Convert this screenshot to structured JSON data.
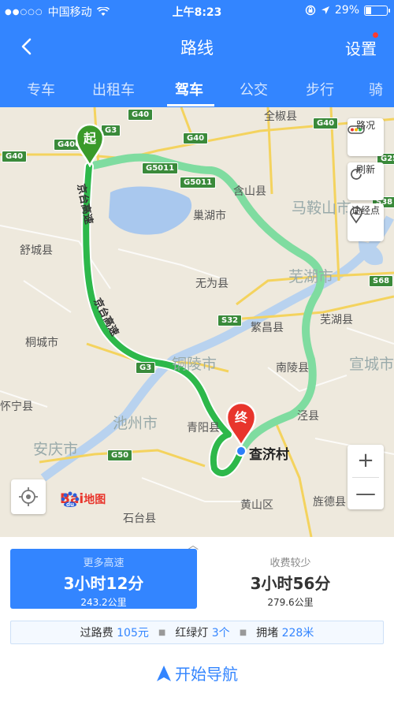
{
  "status_bar": {
    "carrier": "中国移动",
    "time": "上午8:23",
    "battery": "29%",
    "battery_level": 0.29
  },
  "nav": {
    "title": "路线",
    "settings": "设置"
  },
  "tabs": [
    "专车",
    "出租车",
    "驾车",
    "公交",
    "步行",
    "骑"
  ],
  "active_tab": "驾车",
  "map": {
    "start_label": "起",
    "end_label": "终",
    "destination": "查济村",
    "places": {
      "quanjiao": "全椒县",
      "hanshan": "含山县",
      "chaohu": "巢湖市",
      "maanshan": "马鞍山市",
      "shucheng": "舒城县",
      "wuhu_city": "芜湖市",
      "wuwei": "无为县",
      "tongcheng": "桐城市",
      "fanchang": "繁昌县",
      "wuhu_county": "芜湖县",
      "tongling": "铜陵市",
      "nanling": "南陵县",
      "xuancheng": "宣城市",
      "huaining": "怀宁县",
      "chizhou": "池州市",
      "qingyang": "青阳县",
      "jingxian": "泾县",
      "anqing": "安庆市",
      "huangshan_district": "黄山区",
      "jingde": "旌德县",
      "shitai": "石台县"
    },
    "road_names": [
      "京台高速",
      "京台高速"
    ],
    "shields": [
      "G40",
      "G3",
      "G40",
      "G400",
      "G40",
      "G5011",
      "G5011",
      "G40",
      "G2501",
      "S38",
      "S68",
      "S32",
      "G3",
      "G50"
    ],
    "buttons": {
      "traffic": "路况",
      "refresh": "刷新",
      "waypoints": "途经点",
      "zoom_in": "+",
      "zoom_out": "—"
    },
    "logo": {
      "bai": "Bai",
      "du": "du",
      "ditu": "地图"
    }
  },
  "routes": [
    {
      "tag": "更多高速",
      "time": "3小时12分",
      "distance": "243.2公里"
    },
    {
      "tag": "收费较少",
      "time": "3小时56分",
      "distance": "279.6公里"
    }
  ],
  "info": {
    "toll_label": "过路费",
    "toll_value": "105元",
    "lights_label": "红绿灯",
    "lights_value": "3个",
    "jam_label": "拥堵",
    "jam_value": "228米"
  },
  "start_navigation": "开始导航",
  "colors": {
    "brand_blue": "#3385ff",
    "route_main": "#2db84a",
    "route_alt": "#7fdca0",
    "start_pin": "#3a9a2a",
    "end_pin": "#e8352c"
  }
}
